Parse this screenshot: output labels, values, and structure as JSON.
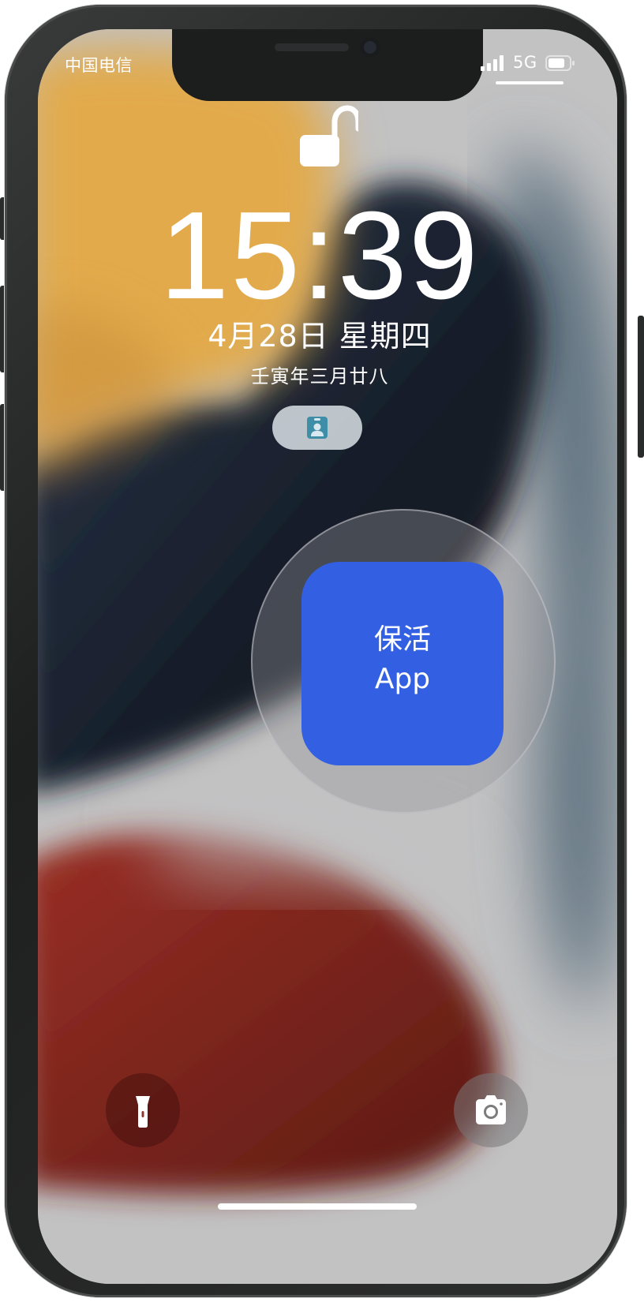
{
  "status_bar": {
    "carrier": "中国电信",
    "network": "5G",
    "signal_icon": "cellular-signal-icon",
    "battery_icon": "battery-icon"
  },
  "lock_screen": {
    "lock_state_icon": "unlocked-padlock-icon",
    "time": "15:39",
    "date": "4月28日 星期四",
    "lunar_date": "壬寅年三月廿八",
    "widget_icon": "contact-card-icon"
  },
  "highlight": {
    "app_label": "保活\nApp",
    "tile_color": "#3360e3"
  },
  "quick_actions": {
    "flashlight_icon": "flashlight-icon",
    "camera_icon": "camera-icon"
  },
  "colors": {
    "wallpaper_orange": "#e3a94a",
    "wallpaper_navy": "#1c2333",
    "wallpaper_red": "#8c2a22",
    "wallpaper_gray": "#bdbdbe",
    "frame": "#1e1f1f"
  }
}
